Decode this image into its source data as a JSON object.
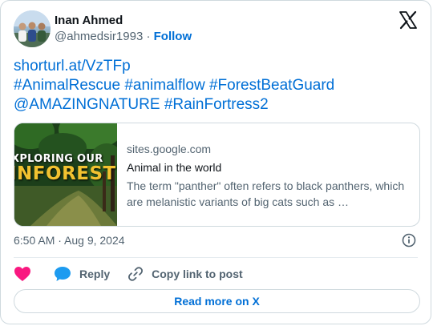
{
  "author": {
    "display_name": "Inan Ahmed",
    "handle": "@ahmedsir1993",
    "separator": " · ",
    "follow_label": "Follow"
  },
  "tweet": {
    "lines": [
      "shorturl.at/VzTFp",
      "#AnimalRescue #animalflow #ForestBeatGuard",
      "@AMAZINGNATURE #RainFortress2"
    ]
  },
  "link_card": {
    "thumbnail_text_1": "XPLORING OUR",
    "thumbnail_text_2": "INFOREST",
    "domain": "sites.google.com",
    "title": "Animal in the world",
    "description": "The term \"panther\" often refers to black panthers, which are melanistic variants of big cats such as …"
  },
  "meta": {
    "timestamp": "6:50 AM · Aug 9, 2024"
  },
  "actions": {
    "reply_label": "Reply",
    "copy_label": "Copy link to post"
  },
  "footer": {
    "read_more_label": "Read more on X"
  },
  "icons": {
    "like": "heart-icon",
    "reply": "speech-bubble-icon",
    "copy": "link-icon",
    "info": "info-icon",
    "brand": "x-logo-icon"
  },
  "colors": {
    "link_blue": "#006fd6",
    "like_pink": "#f91880",
    "reply_blue": "#1d9bf0",
    "muted": "#536471"
  }
}
